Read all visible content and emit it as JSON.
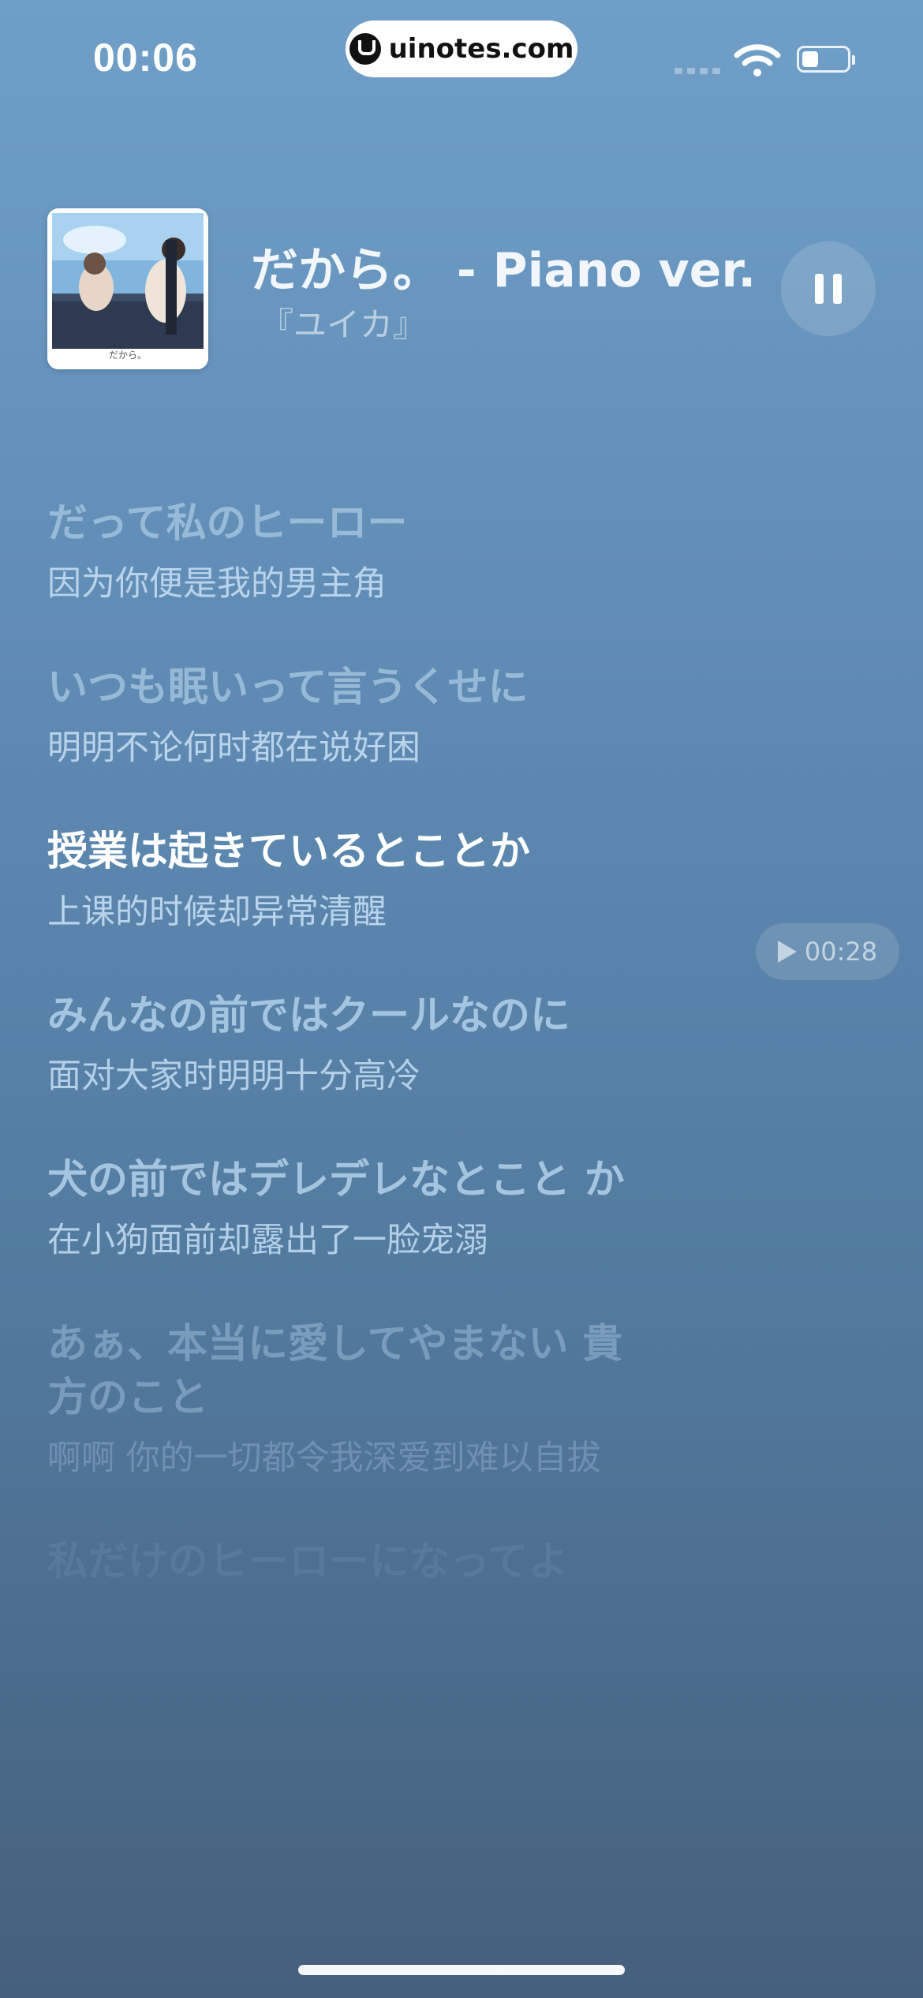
{
  "status_bar": {
    "time": "00:06",
    "site": "uinotes.com"
  },
  "now_playing": {
    "title": "だから。 - Piano ver.",
    "artist": "『ユイカ』",
    "album_art_text": "だから。",
    "play_state": "playing"
  },
  "lyrics": [
    {
      "jp": "だって私のヒーロー",
      "cn": "因为你便是我的男主角",
      "state": "past"
    },
    {
      "jp": "いつも眠いって言うくせに",
      "cn": "明明不论何时都在说好困",
      "state": "past"
    },
    {
      "jp": "授業は起きているとことか",
      "cn": "上课的时候却异常清醒",
      "state": "current"
    },
    {
      "jp": "みんなの前ではクールなのに",
      "cn": "面对大家时明明十分高冷",
      "state": "upcoming"
    },
    {
      "jp": "犬の前ではデレデレなとこと か",
      "cn": "在小狗面前却露出了一脸宠溺",
      "state": "upcoming"
    },
    {
      "jp": "あぁ、本当に愛してやまない 貴方のこと",
      "cn": "啊啊 你的一切都令我深爱到难以自拔",
      "state": "fading"
    },
    {
      "jp": "私だけのヒーローになってよ",
      "cn": "",
      "state": "faded"
    }
  ],
  "seek_chip": {
    "time": "00:28"
  },
  "colors": {
    "current_line": "#ffffff",
    "dim_line": "#a9c8e4",
    "faint_line": "#8fb0cf"
  }
}
